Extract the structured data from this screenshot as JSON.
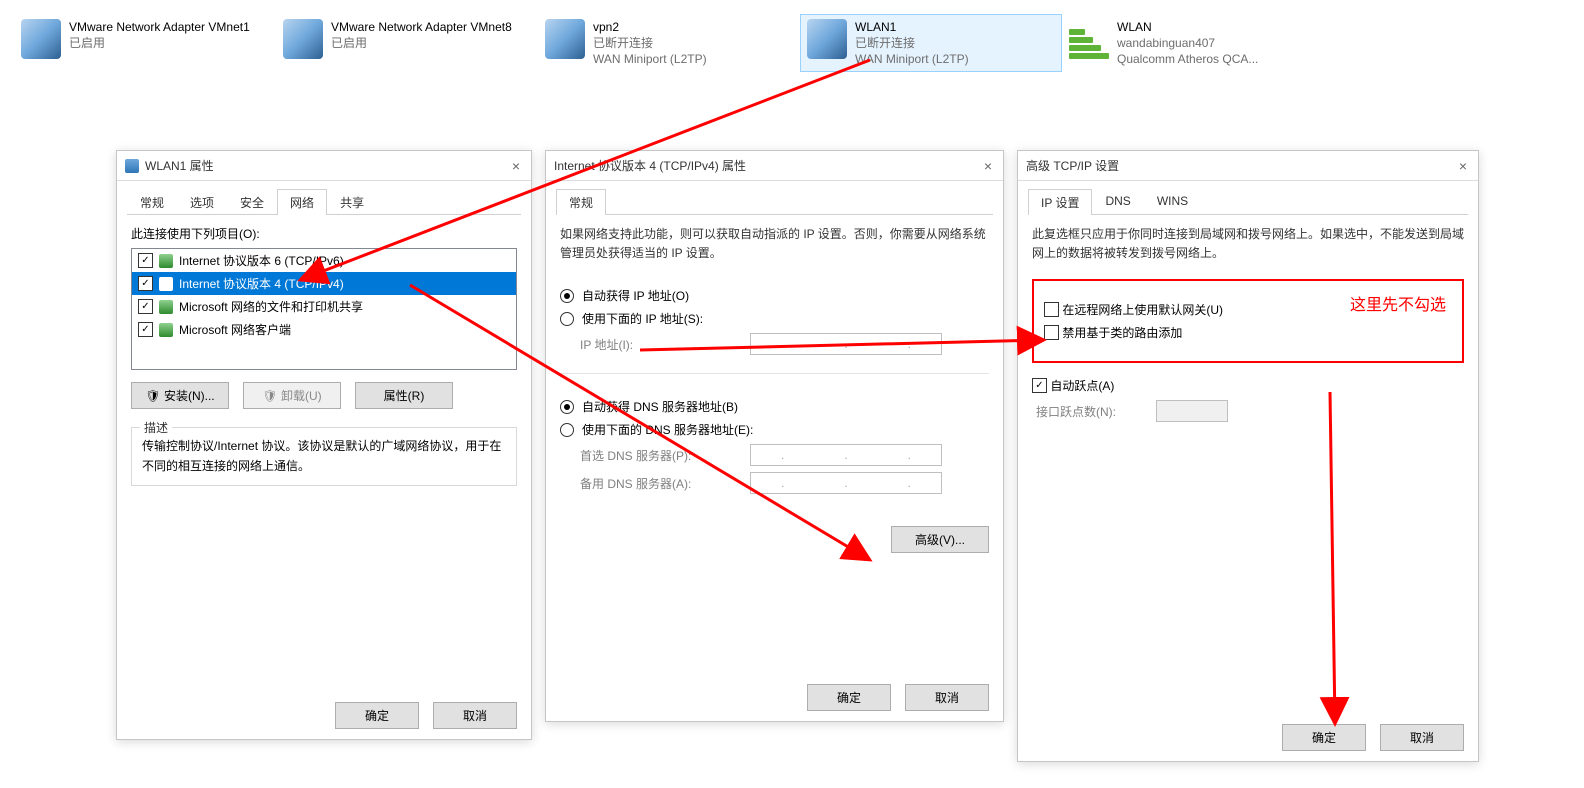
{
  "adapters": [
    {
      "name": "VMware Network Adapter VMnet1",
      "line2": "已启用",
      "line3": "",
      "icon": "net"
    },
    {
      "name": "VMware Network Adapter VMnet8",
      "line2": "已启用",
      "line3": "",
      "icon": "net"
    },
    {
      "name": "vpn2",
      "line2": "已断开连接",
      "line3": "WAN Miniport (L2TP)",
      "icon": "net"
    },
    {
      "name": "WLAN1",
      "line2": "已断开连接",
      "line3": "WAN Miniport (L2TP)",
      "icon": "net",
      "selected": true
    },
    {
      "name": "WLAN",
      "line2": "wandabinguan407",
      "line3": "Qualcomm Atheros QCA...",
      "icon": "wifi"
    }
  ],
  "dlgProps": {
    "title": "WLAN1 属性",
    "tabs": [
      "常规",
      "选项",
      "安全",
      "网络",
      "共享"
    ],
    "activeTab": 3,
    "listLabel": "此连接使用下列项目(O):",
    "items": [
      {
        "label": "Internet 协议版本 6 (TCP/IPv6)",
        "checked": true
      },
      {
        "label": "Internet 协议版本 4 (TCP/IPv4)",
        "checked": true,
        "selected": true
      },
      {
        "label": "Microsoft 网络的文件和打印机共享",
        "checked": true
      },
      {
        "label": "Microsoft 网络客户端",
        "checked": true
      }
    ],
    "btnInstall": "安装(N)...",
    "btnUninstall": "卸载(U)",
    "btnProps": "属性(R)",
    "descTitle": "描述",
    "descText": "传输控制协议/Internet 协议。该协议是默认的广域网络协议，用于在不同的相互连接的网络上通信。",
    "ok": "确定",
    "cancel": "取消"
  },
  "dlgIpv4": {
    "title": "Internet 协议版本 4 (TCP/IPv4) 属性",
    "tab": "常规",
    "intro": "如果网络支持此功能，则可以获取自动指派的 IP 设置。否则，你需要从网络系统管理员处获得适当的 IP 设置。",
    "r1": "自动获得 IP 地址(O)",
    "r2": "使用下面的 IP 地址(S):",
    "ipLbl": "IP 地址(I):",
    "r3": "自动获得 DNS 服务器地址(B)",
    "r4": "使用下面的 DNS 服务器地址(E):",
    "dns1": "首选 DNS 服务器(P):",
    "dns2": "备用 DNS 服务器(A):",
    "adv": "高级(V)...",
    "ok": "确定",
    "cancel": "取消"
  },
  "dlgAdv": {
    "title": "高级 TCP/IP 设置",
    "tabs": [
      "IP 设置",
      "DNS",
      "WINS"
    ],
    "activeTab": 0,
    "intro": "此复选框只应用于你同时连接到局域网和拨号网络上。如果选中，不能发送到局域网上的数据将被转发到拨号网络上。",
    "c1": "在远程网络上使用默认网关(U)",
    "c2": "禁用基于类的路由添加",
    "c3": "自动跃点(A)",
    "metric": "接口跃点数(N):",
    "ok": "确定",
    "cancel": "取消"
  },
  "annotation": "这里先不勾选"
}
